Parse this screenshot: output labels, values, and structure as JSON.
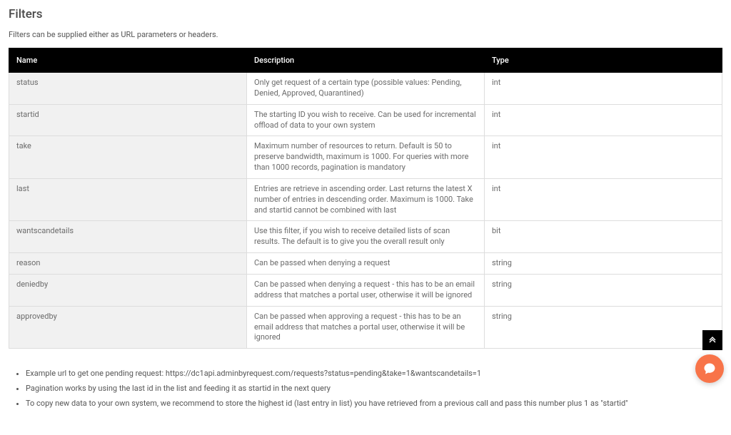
{
  "title": "Filters",
  "intro": "Filters can be supplied either as URL parameters or headers.",
  "table": {
    "headers": {
      "name": "Name",
      "description": "Description",
      "type": "Type"
    },
    "rows": [
      {
        "name": "status",
        "description": "Only get request of a certain type (possible values: Pending, Denied, Approved, Quarantined)",
        "type": "int"
      },
      {
        "name": "startid",
        "description": "The starting ID you wish to receive. Can be used for incremental offload of data to your own system",
        "type": "int"
      },
      {
        "name": "take",
        "description": "Maximum number of resources to return. Default is 50 to preserve bandwidth, maximum is 1000. For queries with more than 1000 records, pagination is mandatory",
        "type": "int"
      },
      {
        "name": "last",
        "description": "Entries are retrieve in ascending order. Last returns the latest X number of entries in descending order. Maximum is 1000. Take and startid cannot be combined with last",
        "type": "int"
      },
      {
        "name": "wantscandetails",
        "description": "Use this filter, if you wish to receive detailed lists of scan results. The default is to give you the overall result only",
        "type": "bit"
      },
      {
        "name": "reason",
        "description": "Can be passed when denying a request",
        "type": "string"
      },
      {
        "name": "deniedby",
        "description": "Can be passed when denying a request - this has to be an email address that matches a portal user, otherwise it will be ignored",
        "type": "string"
      },
      {
        "name": "approvedby",
        "description": "Can be passed when approving a request - this has to be an email address that matches a portal user, otherwise it will be ignored",
        "type": "string"
      }
    ]
  },
  "notes": [
    "Example url to get one pending request: https://dc1api.adminbyrequest.com/requests?status=pending&take=1&wantscandetails=1",
    "Pagination works by using the last id in the list and feeding it as startid in the next query",
    "To copy new data to your own system, we recommend to store the highest id (last entry in list) you have retrieved from a previous call and pass this number plus 1 as \"startid\""
  ]
}
